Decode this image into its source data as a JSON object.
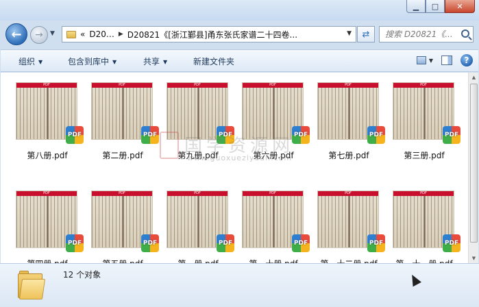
{
  "window": {
    "minimize_glyph": "▁",
    "maximize_glyph": "□",
    "close_glyph": "✕"
  },
  "nav": {
    "back_glyph": "←",
    "forward_glyph": "→",
    "breadcrumb": {
      "overflow": "«",
      "crumbs": [
        "D20…",
        "D20821《[浙江鄞县]甬东张氏家谱二十四卷..."
      ]
    },
    "search_placeholder": "搜索 D20821《..."
  },
  "toolbar": {
    "organize": "组织",
    "include_in_library": "包含到库中",
    "share": "共享",
    "new_folder": "新建文件夹",
    "help": "?"
  },
  "files": [
    {
      "name": "第八册.pdf",
      "row": 0,
      "col": 0
    },
    {
      "name": "第二册.pdf",
      "row": 0,
      "col": 1
    },
    {
      "name": "第九册.pdf",
      "row": 0,
      "col": 2
    },
    {
      "name": "第六册.pdf",
      "row": 0,
      "col": 3
    },
    {
      "name": "第七册.pdf",
      "row": 0,
      "col": 4
    },
    {
      "name": "第三册.pdf",
      "row": 0,
      "col": 5
    },
    {
      "name": "第四册.pdf",
      "row": 1,
      "col": 0
    },
    {
      "name": "第五册.pdf",
      "row": 1,
      "col": 1
    },
    {
      "name": "第一册.pdf",
      "row": 1,
      "col": 2
    },
    {
      "name": "第一十册.pdf",
      "row": 1,
      "col": 3
    },
    {
      "name": "第一十二册.pdf",
      "row": 1,
      "col": 4
    },
    {
      "name": "第一十一册.pdf",
      "row": 1,
      "col": 5
    }
  ],
  "thumb_label": "PDF",
  "badge_label": "PDF",
  "watermark": {
    "text": "国学资源网",
    "url": "www.guoxueziyuan.com"
  },
  "status": {
    "count_text": "12 个对象"
  }
}
